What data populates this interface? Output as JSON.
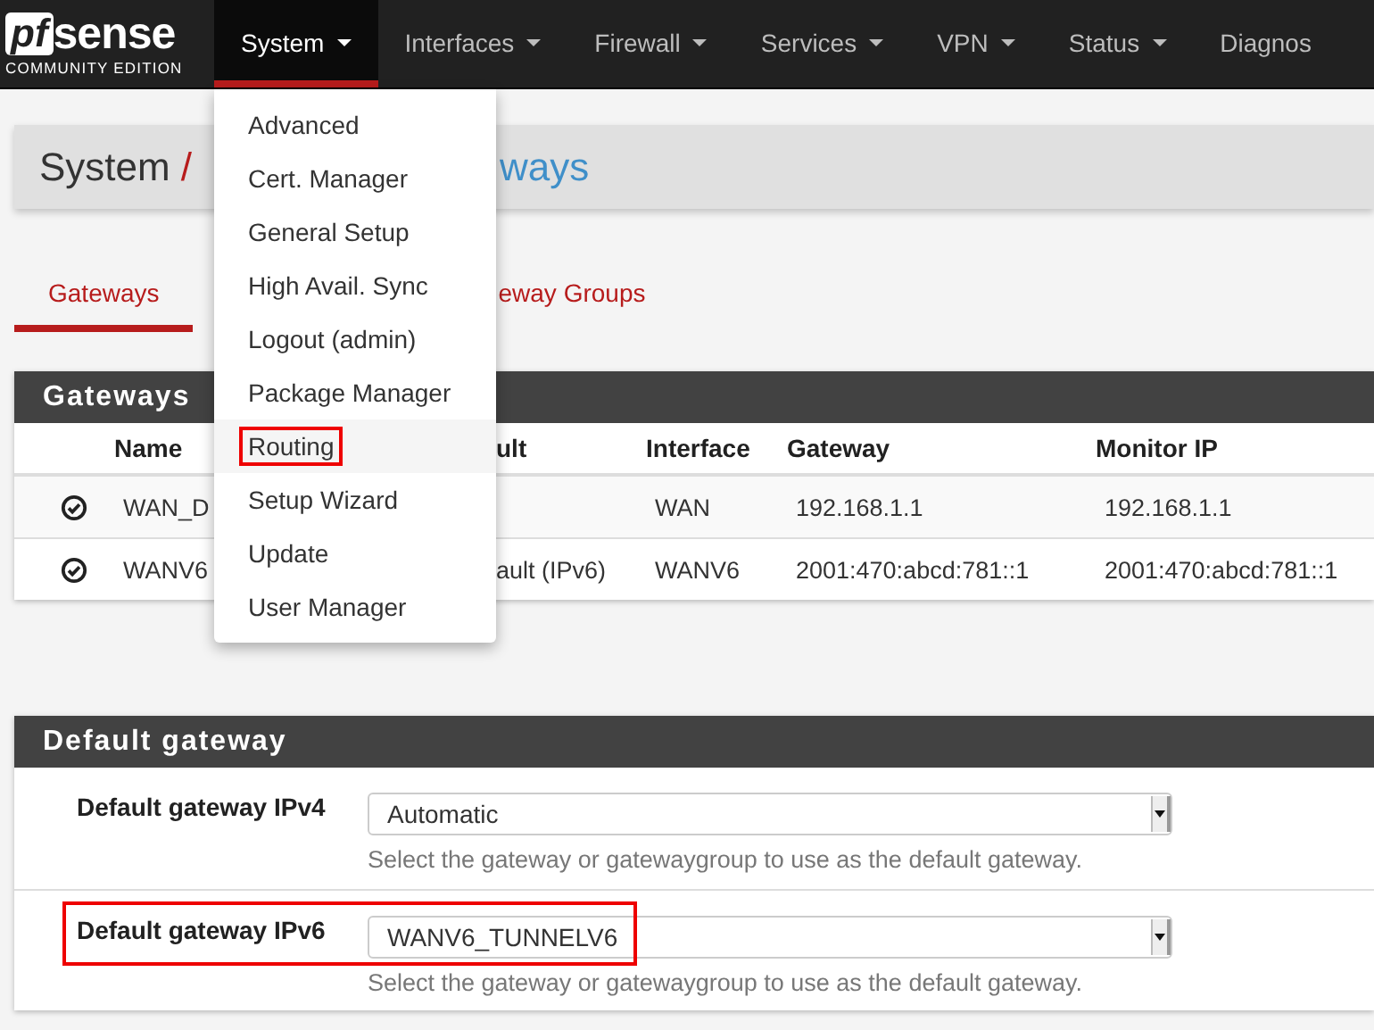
{
  "navbar": {
    "logo": {
      "mark": "pf",
      "name": "sense",
      "edition": "COMMUNITY EDITION"
    },
    "items": [
      {
        "label": "System",
        "caret": true,
        "selected": true
      },
      {
        "label": "Interfaces",
        "caret": true,
        "selected": false
      },
      {
        "label": "Firewall",
        "caret": true,
        "selected": false
      },
      {
        "label": "Services",
        "caret": true,
        "selected": false
      },
      {
        "label": "VPN",
        "caret": true,
        "selected": false
      },
      {
        "label": "Status",
        "caret": true,
        "selected": false
      },
      {
        "label": "Diagnos",
        "caret": false,
        "selected": false
      }
    ]
  },
  "system_menu": {
    "items": [
      {
        "label": "Advanced",
        "highlighted": false
      },
      {
        "label": "Cert. Manager",
        "highlighted": false
      },
      {
        "label": "General Setup",
        "highlighted": false
      },
      {
        "label": "High Avail. Sync",
        "highlighted": false
      },
      {
        "label": "Logout (admin)",
        "highlighted": false
      },
      {
        "label": "Package Manager",
        "highlighted": false
      },
      {
        "label": "Routing",
        "highlighted": true
      },
      {
        "label": "Setup Wizard",
        "highlighted": false
      },
      {
        "label": "Update",
        "highlighted": false
      },
      {
        "label": "User Manager",
        "highlighted": false
      }
    ]
  },
  "breadcrumb": {
    "root": "System",
    "separator": "/",
    "current": "ways"
  },
  "tabs": [
    {
      "label": "Gateways",
      "selected": true
    },
    {
      "label": "eway Groups",
      "selected": false
    }
  ],
  "gateways": {
    "title": "Gateways",
    "columns": [
      "Name",
      "ult",
      "Interface",
      "Gateway",
      "Monitor IP"
    ],
    "rows": [
      {
        "online": true,
        "name": "WAN_D",
        "interface": "WAN",
        "gateway": "192.168.1.1",
        "monitor_ip": "192.168.1.1"
      },
      {
        "online": true,
        "name": "WANV6",
        "description": "ault (IPv6)",
        "interface": "WANV6",
        "gateway": "2001:470:abcd:781::1",
        "monitor_ip": "2001:470:abcd:781::1"
      }
    ]
  },
  "default_gateway": {
    "title": "Default gateway",
    "rows": [
      {
        "label": "Default gateway IPv4",
        "value": "Automatic",
        "help": "Select the gateway or gatewaygroup to use as the default gateway.",
        "highlighted": false
      },
      {
        "label": "Default gateway IPv6",
        "value": "WANV6_TUNNELV6",
        "help": "Select the gateway or gatewaygroup to use as the default gateway.",
        "highlighted": true
      }
    ]
  }
}
